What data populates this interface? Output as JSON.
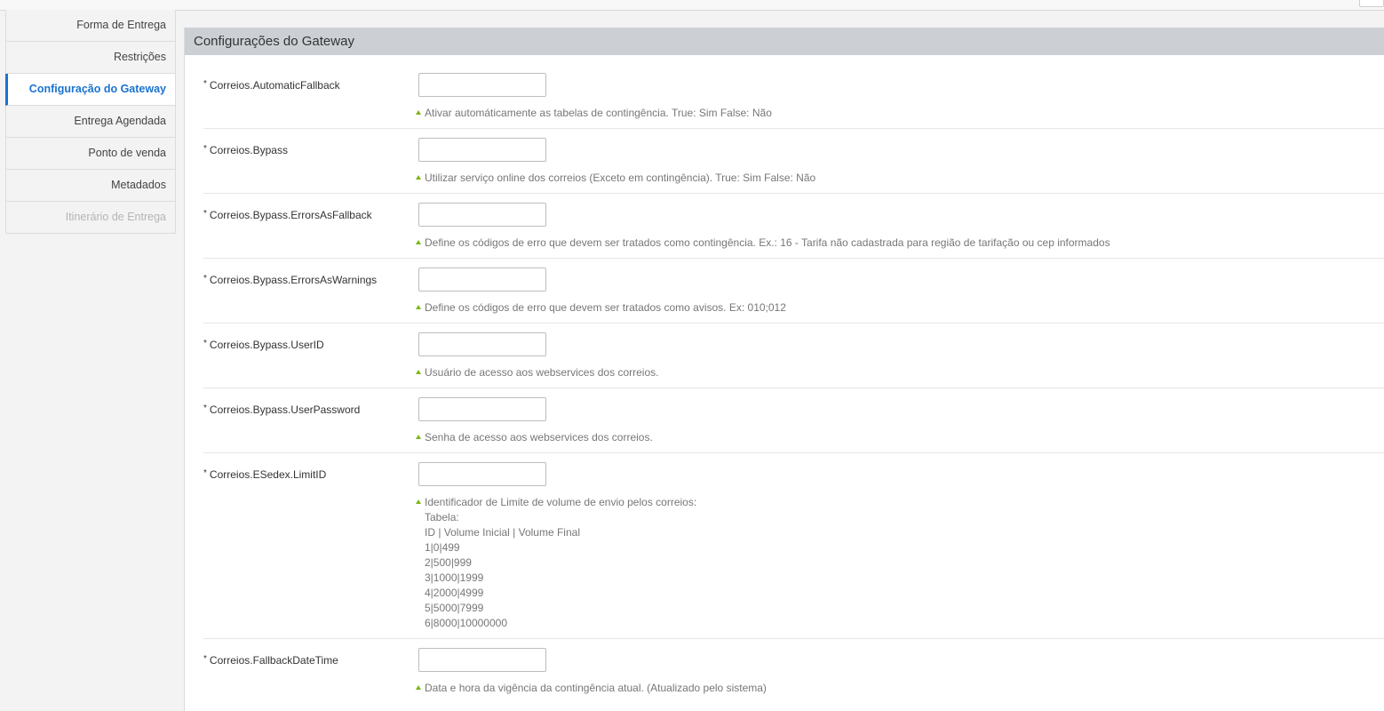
{
  "sidebar": {
    "items": [
      {
        "label": "Forma de Entrega",
        "state": "normal"
      },
      {
        "label": "Restrições",
        "state": "normal"
      },
      {
        "label": "Configuração do Gateway",
        "state": "active"
      },
      {
        "label": "Entrega Agendada",
        "state": "normal"
      },
      {
        "label": "Ponto de venda",
        "state": "normal"
      },
      {
        "label": "Metadados",
        "state": "normal"
      },
      {
        "label": "Itinerário de Entrega",
        "state": "disabled"
      }
    ]
  },
  "panel": {
    "title": "Configurações do Gateway"
  },
  "fields": [
    {
      "required_mark": "*",
      "label": "Correios.AutomaticFallback",
      "value": "",
      "help": "Ativar automáticamente as tabelas de contingência. True: Sim False: Não"
    },
    {
      "required_mark": "*",
      "label": "Correios.Bypass",
      "value": "",
      "help": "Utilizar serviço online dos correios (Exceto em contingência). True: Sim False: Não"
    },
    {
      "required_mark": "*",
      "label": "Correios.Bypass.ErrorsAsFallback",
      "value": "",
      "help": "Define os códigos de erro que devem ser tratados como contingência. Ex.: 16 - Tarifa não cadastrada para região de tarifação ou cep informados"
    },
    {
      "required_mark": "*",
      "label": "Correios.Bypass.ErrorsAsWarnings",
      "value": "",
      "help": "Define os códigos de erro que devem ser tratados como avisos. Ex: 010;012"
    },
    {
      "required_mark": "*",
      "label": "Correios.Bypass.UserID",
      "value": "",
      "help": "Usuário de acesso aos webservices dos correios."
    },
    {
      "required_mark": "*",
      "label": "Correios.Bypass.UserPassword",
      "value": "",
      "help": "Senha de acesso aos webservices dos correios."
    },
    {
      "required_mark": "*",
      "label": "Correios.ESedex.LimitID",
      "value": "",
      "help": "Identificador de Limite de volume de envio pelos correios:\nTabela:\nID | Volume Inicial | Volume Final\n1|0|499\n2|500|999\n3|1000|1999\n4|2000|4999\n5|5000|7999\n6|8000|10000000"
    },
    {
      "required_mark": "*",
      "label": "Correios.FallbackDateTime",
      "value": "",
      "help": "Data e hora da vigência da contingência atual. (Atualizado pelo sistema)"
    }
  ],
  "colors": {
    "active_link": "#1a73d1",
    "help_arrow": "#7cb518",
    "header_bg": "#ccd0d4"
  }
}
